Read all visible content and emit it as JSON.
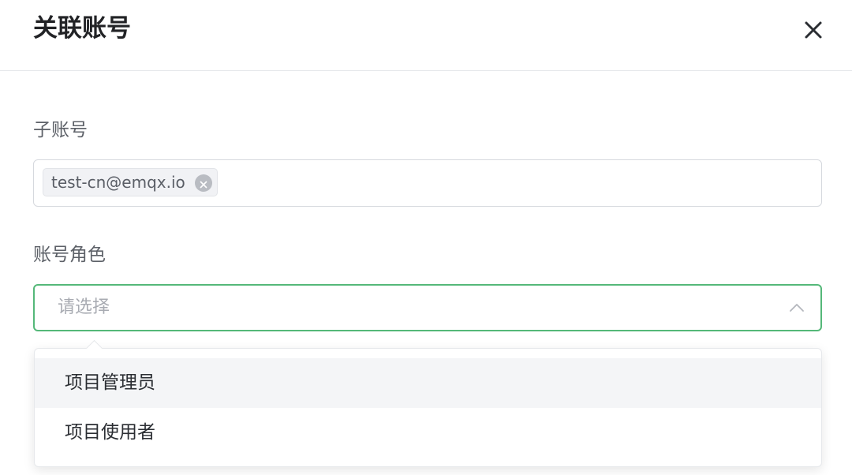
{
  "dialog": {
    "title": "关联账号"
  },
  "sub_account": {
    "label": "子账号",
    "tags": [
      "test-cn@emqx.io"
    ]
  },
  "account_role": {
    "label": "账号角色",
    "placeholder": "请选择",
    "options": [
      "项目管理员",
      "项目使用者"
    ],
    "highlighted_option": "项目管理员",
    "dropdown_open": true
  },
  "colors": {
    "focus_border": "#55b879",
    "option_hover_bg": "#f4f5f7"
  },
  "icons": {
    "close": "close-icon",
    "tag_remove": "close-circle-icon",
    "dropdown_arrow": "chevron-up-icon"
  }
}
